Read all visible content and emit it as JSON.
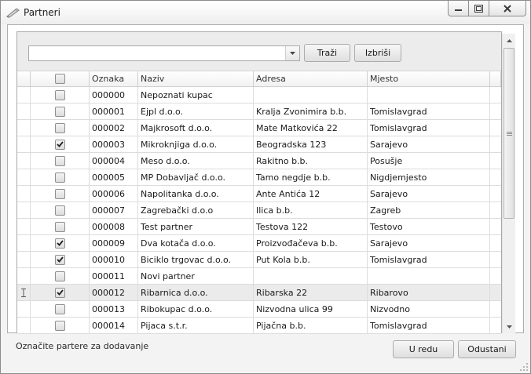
{
  "window": {
    "title": "Partneri",
    "icon": "pen-icon",
    "controls": [
      "minimize-icon",
      "maximize-icon",
      "close-icon"
    ]
  },
  "search": {
    "value": "",
    "search_label": "Traži",
    "delete_label": "Izbriši"
  },
  "grid": {
    "columns": {
      "code": "Oznaka",
      "name": "Naziv",
      "address": "Adresa",
      "place": "Mjesto"
    },
    "rows": [
      {
        "checked": false,
        "code": "000000",
        "name": "Nepoznati kupac",
        "address": "",
        "place": ""
      },
      {
        "checked": false,
        "code": "000001",
        "name": "Ejpl d.o.o.",
        "address": "Kralja Zvonimira b.b.",
        "place": "Tomislavgrad"
      },
      {
        "checked": false,
        "code": "000002",
        "name": "Majkrosoft d.o.o.",
        "address": "Mate Matkovića 22",
        "place": "Tomislavgrad"
      },
      {
        "checked": true,
        "code": "000003",
        "name": "Mikroknjiga d.o.o.",
        "address": "Beogradska 123",
        "place": "Sarajevo"
      },
      {
        "checked": false,
        "code": "000004",
        "name": "Meso d.o.o.",
        "address": "Rakitno b.b.",
        "place": "Posušje"
      },
      {
        "checked": false,
        "code": "000005",
        "name": "MP Dobavljač d.o.o.",
        "address": "Tamo negdje b.b.",
        "place": "Nigdjemjesto"
      },
      {
        "checked": false,
        "code": "000006",
        "name": "Napolitanka d.o.o.",
        "address": "Ante Antića 12",
        "place": "Sarajevo"
      },
      {
        "checked": false,
        "code": "000007",
        "name": "Zagrebački d.o.o",
        "address": "Ilica b.b.",
        "place": "Zagreb"
      },
      {
        "checked": false,
        "code": "000008",
        "name": "Test partner",
        "address": "Testova 122",
        "place": "Testovo"
      },
      {
        "checked": true,
        "code": "000009",
        "name": "Dva kotača d.o.o.",
        "address": "Proizvođačeva b.b.",
        "place": "Sarajevo"
      },
      {
        "checked": true,
        "code": "000010",
        "name": "Biciklo trgovac d.o.o.",
        "address": "Put Kola b.b.",
        "place": "Tomislavgrad"
      },
      {
        "checked": false,
        "code": "000011",
        "name": "Novi partner",
        "address": "",
        "place": ""
      },
      {
        "checked": true,
        "code": "000012",
        "name": "Ribarnica d.o.o.",
        "address": "Ribarska 22",
        "place": "Ribarovo",
        "selected": true
      },
      {
        "checked": false,
        "code": "000013",
        "name": "Ribokupac d.o.o.",
        "address": "Nizvodna ulica 99",
        "place": "Nizvodno"
      },
      {
        "checked": false,
        "code": "000014",
        "name": "Pijaca s.t.r.",
        "address": "Pijačna b.b.",
        "place": "Tomislavgrad"
      }
    ]
  },
  "footer": {
    "hint": "Označite partere za dodavanje",
    "ok_label": "U redu",
    "cancel_label": "Odustani"
  }
}
